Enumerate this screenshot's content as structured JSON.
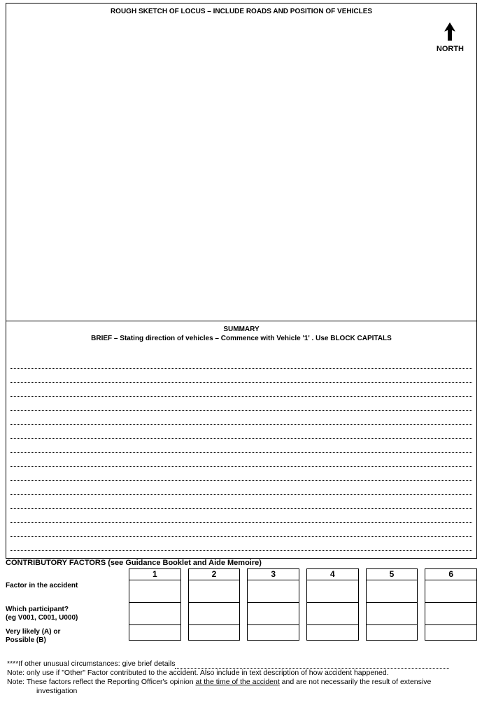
{
  "sketch": {
    "title": "ROUGH SKETCH OF LOCUS – INCLUDE ROADS AND POSITION OF VEHICLES",
    "northLabel": "NORTH"
  },
  "summary": {
    "title": "SUMMARY",
    "subtitle": "BRIEF – Stating direction of vehicles – Commence with Vehicle '1' . Use BLOCK CAPITALS"
  },
  "factors": {
    "heading": "CONTRIBUTORY FACTORS (see Guidance Booklet and Aide Memoire)",
    "cols": [
      "1",
      "2",
      "3",
      "4",
      "5",
      "6"
    ],
    "rowLabels": {
      "factor": "Factor in the accident",
      "participant": "Which participant?",
      "participantEg": "(eg V001, C001, U000)",
      "likelihood1": "Very likely (A) or",
      "likelihood2": "Possible (B)"
    }
  },
  "notes": {
    "line1": "****If other unusual circumstances: give brief details",
    "line2": "Note: only use if \"Other\" Factor contributed to the accident.  Also include in text description of how accident happened.",
    "line3a": "Note: These factors reflect the Reporting Officer's opinion ",
    "line3u": "at the time of the accident",
    "line3b": " and are not necessarily the result of extensive",
    "line4": "investigation"
  }
}
